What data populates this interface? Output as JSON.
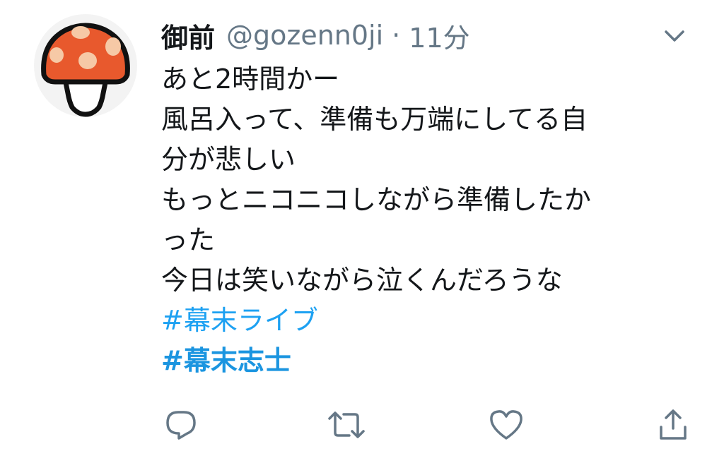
{
  "tweet": {
    "author": {
      "display_name": "御前",
      "handle": "@gozenn0ji",
      "separator": "·",
      "time": "11分"
    },
    "lines": [
      "あと2時間かー",
      "風呂入って、準備も万端にしてる自",
      "分が悲しい",
      "もっとニコニコしながら準備したか",
      "った",
      "今日は笑いながら泣くんだろうな"
    ],
    "hashtags": [
      "#幕末ライブ",
      "#幕末志士"
    ]
  },
  "icons": {
    "avatar": "mushroom-avatar",
    "menu": "chevron-down-icon",
    "reply": "reply-icon",
    "retweet": "retweet-icon",
    "like": "heart-icon",
    "share": "share-icon"
  },
  "colors": {
    "text": "#14171a",
    "secondary": "#657786",
    "link": "#1da1f2",
    "avatar_cap": "#e8592d",
    "avatar_spots": "#f6c9a6"
  }
}
